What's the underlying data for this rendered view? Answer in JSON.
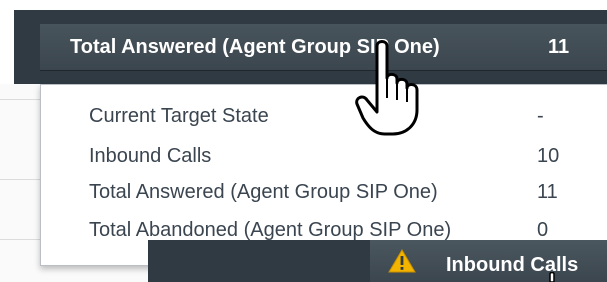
{
  "header": {
    "selector_label": "Total Answered (Agent Group SIP One)",
    "selector_value": "11"
  },
  "dropdown": {
    "items": [
      {
        "label": "Current Target State",
        "value": "-"
      },
      {
        "label": "Inbound Calls",
        "value": "10"
      },
      {
        "label": "Total Answered (Agent Group SIP One)",
        "value": "11"
      },
      {
        "label": "Total Abandoned (Agent Group SIP One)",
        "value": "0"
      }
    ]
  },
  "lower_panel": {
    "tab_label": "Inbound Calls"
  },
  "colors": {
    "header_bg": "#2f3a42",
    "selector_bg": "#3b464e",
    "dropdown_text": "#3a4550",
    "warning": "#f3b400"
  },
  "icons": {
    "cursor": "hand-pointer-icon",
    "caret": "chevron-down-icon",
    "warning": "warning-triangle-icon"
  }
}
